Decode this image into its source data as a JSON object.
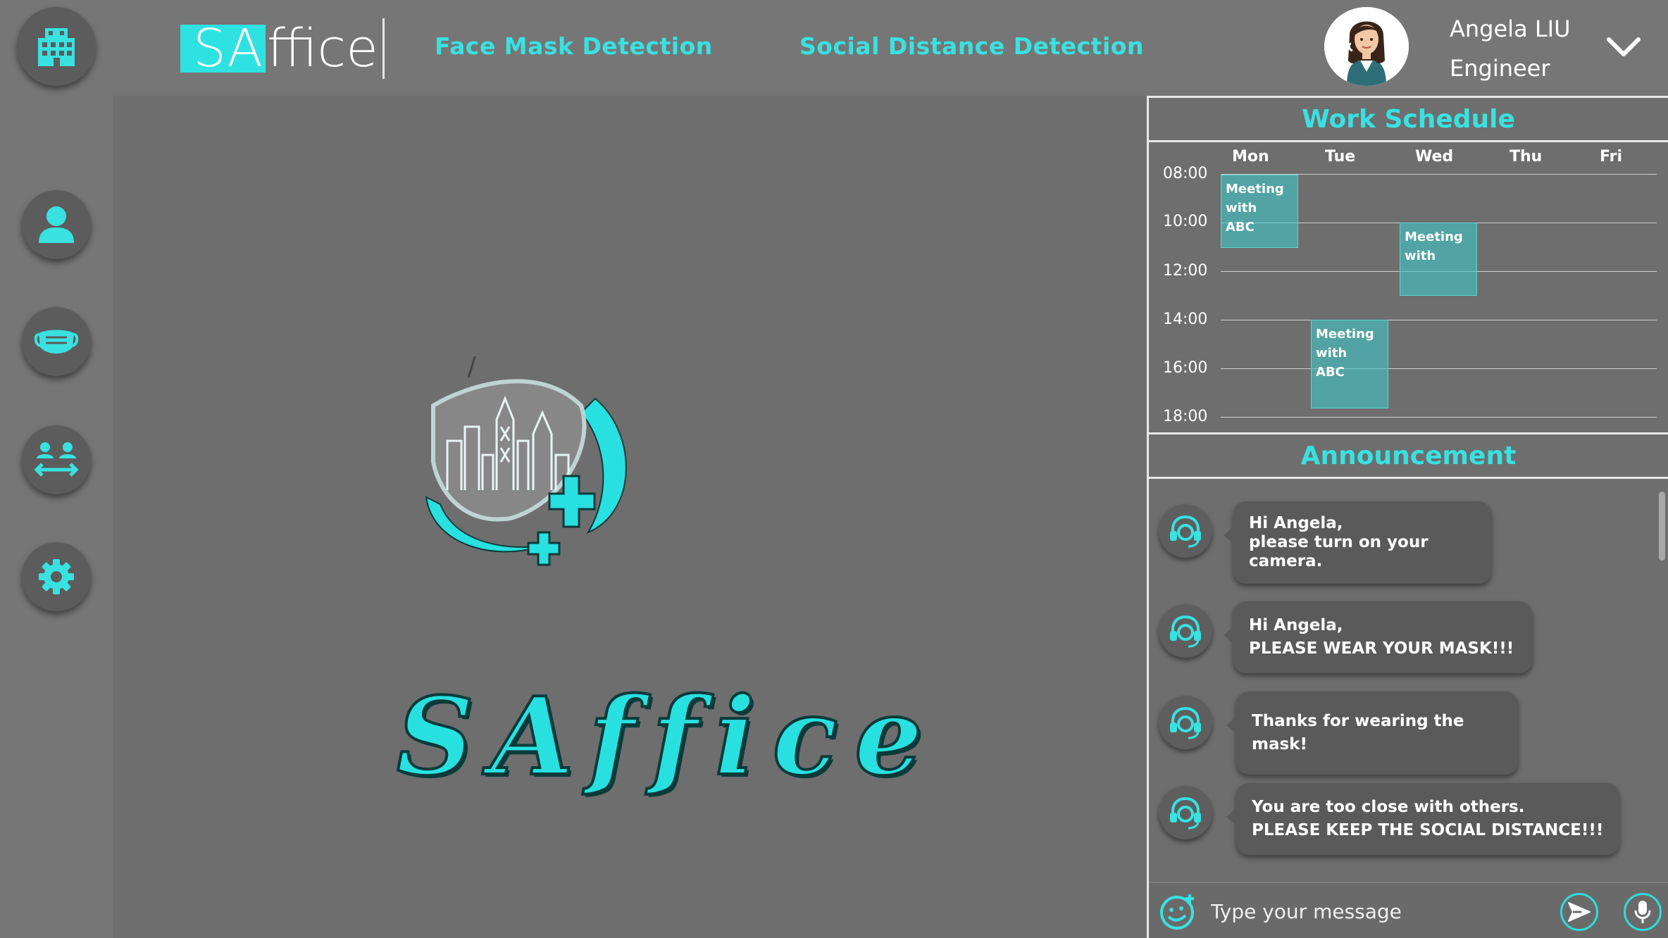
{
  "app": {
    "logo_prefix": "SA",
    "logo_suffix": "ffice",
    "brand_text": "SAffice"
  },
  "nav": {
    "face_mask": "Face Mask Detection",
    "social_distance": "Social Distance Detection"
  },
  "user": {
    "name": "Angela LIU",
    "role": "Engineer"
  },
  "sidebar": {
    "items": [
      "building-icon",
      "user-icon",
      "mask-icon",
      "distance-icon",
      "gear-icon"
    ]
  },
  "schedule": {
    "title": "Work Schedule",
    "days": [
      "Mon",
      "Tue",
      "Wed",
      "Thu",
      "Fri"
    ],
    "times": [
      "08:00",
      "10:00",
      "12:00",
      "14:00",
      "16:00",
      "18:00"
    ],
    "events": [
      {
        "day": "Mon",
        "start": "08:00",
        "end": "11:00",
        "lines": [
          "Meeting",
          "with",
          "ABC"
        ]
      },
      {
        "day": "Wed",
        "start": "10:00",
        "end": "13:00",
        "lines": [
          "Meeting",
          "with"
        ]
      },
      {
        "day": "Tue",
        "start": "14:00",
        "end": "17:30",
        "lines": [
          "Meeting",
          "with",
          "ABC"
        ]
      }
    ]
  },
  "announcement": {
    "title": "Announcement",
    "messages": [
      {
        "line1": "Hi Angela,",
        "line2": "please turn on your camera."
      },
      {
        "line1": "Hi Angela,",
        "line2": "PLEASE WEAR YOUR MASK!!!"
      },
      {
        "line1": "Thanks for wearing the mask!",
        "line2": ""
      },
      {
        "line1": "You are too close with others.",
        "line2": "PLEASE KEEP THE SOCIAL DISTANCE!!!"
      }
    ]
  },
  "composer": {
    "placeholder": "Type your message"
  },
  "colors": {
    "accent": "#39e1e1",
    "background": "#6e6e6e",
    "panel": "#767676"
  }
}
